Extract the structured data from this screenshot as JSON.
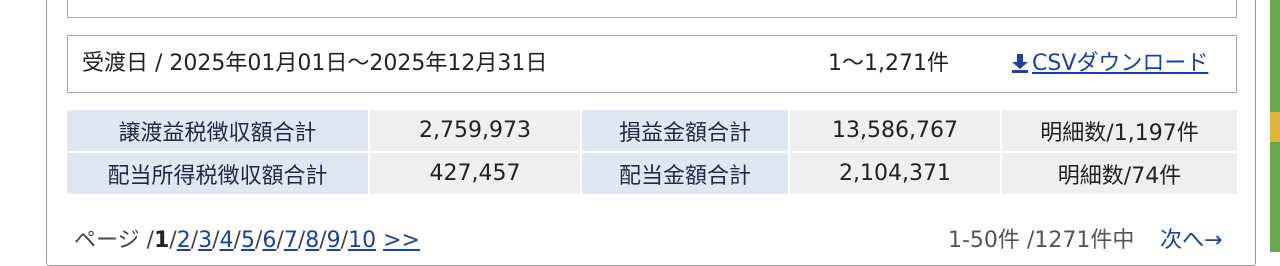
{
  "period": {
    "label": "受渡日 / 2025年01月01日〜2025年12月31日"
  },
  "count": {
    "text": "1〜1,271件"
  },
  "csv": {
    "icon": "download-icon",
    "label": "CSVダウンロード"
  },
  "summary": {
    "rows": [
      {
        "label1": "譲渡益税徴収額合計",
        "value1": "2,759,973",
        "label2": "損益金額合計",
        "value2": "13,586,767",
        "count": "明細数/1,197件"
      },
      {
        "label1": "配当所得税徴収額合計",
        "value1": "427,457",
        "label2": "配当金額合計",
        "value2": "2,104,371",
        "count": "明細数/74件"
      }
    ]
  },
  "pager": {
    "prefix": "ページ /",
    "pages": [
      "1",
      "2",
      "3",
      "4",
      "5",
      "6",
      "7",
      "8",
      "9",
      "10"
    ],
    "more": ">>"
  },
  "range": {
    "text": "1-50件 /1271件中"
  },
  "next": {
    "label": "次へ→"
  },
  "colors": {
    "link": "#1a3fb4",
    "label_bg": "#dfe8f2",
    "value_bg": "#efefef"
  }
}
